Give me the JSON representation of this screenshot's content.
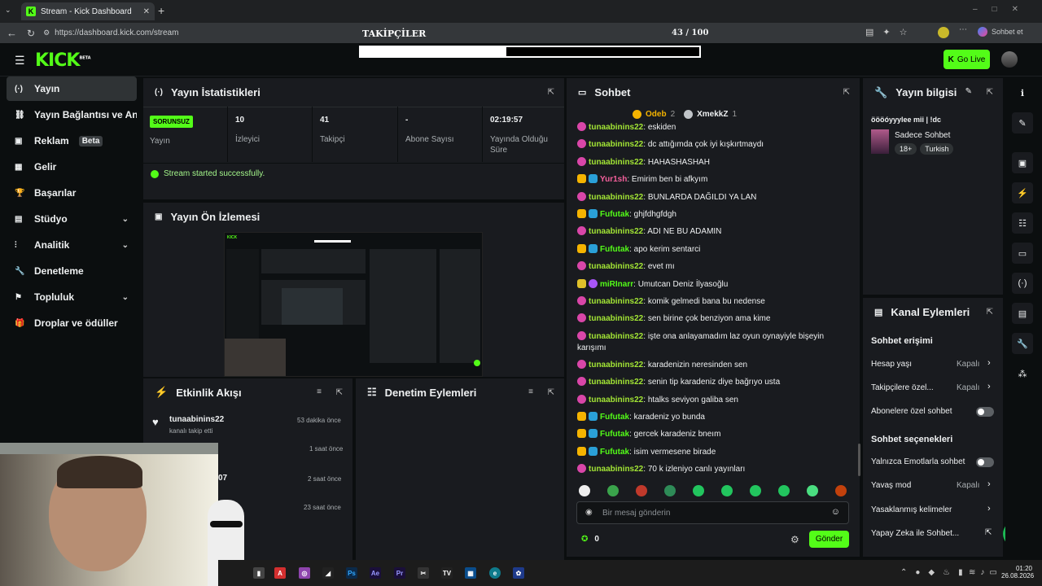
{
  "browser": {
    "tab_title": "Stream - Kick Dashboard",
    "url": "https://dashboard.kick.com/stream",
    "profile_label": "Sohbet et"
  },
  "overlay": {
    "label": "TAKİPÇİLER",
    "count": "43 / 100",
    "progress": 0.43
  },
  "header": {
    "logo": "KICK",
    "logo_badge": "BETA",
    "go_live": "Go Live"
  },
  "sidebar": {
    "items": [
      {
        "label": "Yayın",
        "icon": "broadcast-icon",
        "active": true
      },
      {
        "label": "Yayın Bağlantısı ve Anahtarı",
        "icon": "link-icon"
      },
      {
        "label": "Reklam",
        "icon": "ad-icon",
        "badge": "Beta"
      },
      {
        "label": "Gelir",
        "icon": "revenue-icon"
      },
      {
        "label": "Başarılar",
        "icon": "trophy-icon"
      },
      {
        "label": "Stüdyo",
        "icon": "studio-icon",
        "expand": true
      },
      {
        "label": "Analitik",
        "icon": "analytics-icon",
        "expand": true
      },
      {
        "label": "Denetleme",
        "icon": "wrench-icon"
      },
      {
        "label": "Topluluk",
        "icon": "community-icon",
        "expand": true
      },
      {
        "label": "Droplar ve ödüller",
        "icon": "gift-icon"
      }
    ]
  },
  "stats": {
    "title": "Yayın İstatistikleri",
    "status_badge": "SORUNSUZ",
    "status_label": "Yayın",
    "items": [
      {
        "value": "10",
        "label": "İzleyici"
      },
      {
        "value": "41",
        "label": "Takipçi"
      },
      {
        "value": "-",
        "label": "Abone Sayısı"
      },
      {
        "value": "02:19:57",
        "label": "Yayında Olduğu Süre"
      }
    ],
    "success_message": "Stream started successfully."
  },
  "preview": {
    "title": "Yayın Ön İzlemesi"
  },
  "activity": {
    "title": "Etkinlik Akışı",
    "items": [
      {
        "user": "tunaabinins22",
        "desc": "kanalı takip etti",
        "time": "53 dakika önce"
      },
      {
        "time": "1 saat önce"
      },
      {
        "user": "07",
        "time": "2 saat önce"
      },
      {
        "time": "23 saat önce"
      }
    ]
  },
  "moderation": {
    "title": "Denetim Eylemleri"
  },
  "chat": {
    "title": "Sohbet",
    "top": [
      {
        "name": "Odeb",
        "count": "2"
      },
      {
        "name": "XmekkZ",
        "count": "1"
      }
    ],
    "messages": [
      {
        "user": "tunaabinins22",
        "text": "eskiden",
        "color": "#a3e635"
      },
      {
        "user": "tunaabinins22",
        "text": "dc attığımda çok iyi kışkırtmaydı",
        "color": "#a3e635"
      },
      {
        "user": "tunaabinins22",
        "text": "HAHASHASHAH",
        "color": "#a3e635"
      },
      {
        "user": "Yur1sh",
        "text": "Emirim ben bi afkyım",
        "color": "#f4609c",
        "mod": true
      },
      {
        "user": "tunaabinins22",
        "text": "BUNLARDA DAĞILDI YA LAN",
        "color": "#a3e635"
      },
      {
        "user": "Fufutak",
        "text": "ghjfdhgfdgh",
        "color": "#53fc18",
        "mod": true
      },
      {
        "user": "tunaabinins22",
        "text": "ADI NE BU ADAMIN",
        "color": "#a3e635"
      },
      {
        "user": "Fufutak",
        "text": "apo kerim sentarci",
        "color": "#53fc18",
        "mod": true
      },
      {
        "user": "tunaabinins22",
        "text": "evet mı",
        "color": "#a3e635"
      },
      {
        "user": "miRInarr",
        "text": "Umutcan Deniz İlyasoğlu",
        "color": "#53fc18",
        "sub": true
      },
      {
        "user": "tunaabinins22",
        "text": "komik gelmedi bana bu nedense",
        "color": "#a3e635"
      },
      {
        "user": "tunaabinins22",
        "text": "sen birine çok benziyon ama kime",
        "color": "#a3e635"
      },
      {
        "user": "tunaabinins22",
        "text": "işte ona anlayamadım laz oyun oynayiyle bişeyin karışımı",
        "color": "#a3e635"
      },
      {
        "user": "tunaabinins22",
        "text": "karadenizin neresinden sen",
        "color": "#a3e635"
      },
      {
        "user": "tunaabinins22",
        "text": "senin tip karadeniz diye bağrıyo usta",
        "color": "#a3e635"
      },
      {
        "user": "tunaabinins22",
        "text": "htalks seviyon galiba sen",
        "color": "#a3e635"
      },
      {
        "user": "Fufutak",
        "text": "karadeniz yo bunda",
        "color": "#53fc18",
        "mod": true
      },
      {
        "user": "Fufutak",
        "text": "gercek karadeniz bneım",
        "color": "#53fc18",
        "mod": true
      },
      {
        "user": "Fufutak",
        "text": "isim vermesene birade",
        "color": "#53fc18",
        "mod": true
      },
      {
        "user": "tunaabinins22",
        "text": "70 k izleniyo canlı yayınları",
        "color": "#a3e635"
      }
    ],
    "input_placeholder": "Bir mesaj gönderin",
    "points": "0",
    "send": "Gönder"
  },
  "info": {
    "title": "Yayın bilgisi",
    "stream_title": "öööóyyylee mii | !dc",
    "category": "Sadece Sohbet",
    "tags": [
      "18+",
      "Turkish"
    ]
  },
  "actions": {
    "title": "Kanal Eylemleri",
    "access_title": "Sohbet erişimi",
    "rows1": [
      {
        "label": "Hesap yaşı",
        "value": "Kapalı"
      },
      {
        "label": "Takipçilere özel...",
        "value": "Kapalı"
      },
      {
        "label": "Abonelere özel sohbet"
      }
    ],
    "options_title": "Sohbet seçenekleri",
    "rows2": [
      {
        "label": "Yalnızca Emotlarla sohbet"
      },
      {
        "label": "Yavaş mod",
        "value": "Kapalı"
      },
      {
        "label": "Yasaklanmış kelimeler"
      },
      {
        "label": "Yapay Zeka ile Sohbet..."
      }
    ]
  },
  "taskbar": {
    "time": "01:20",
    "date": "26.08.2026"
  },
  "colors": {
    "accent": "#53fc18",
    "panel": "#191b1f",
    "bg": "#0b0e0f"
  }
}
